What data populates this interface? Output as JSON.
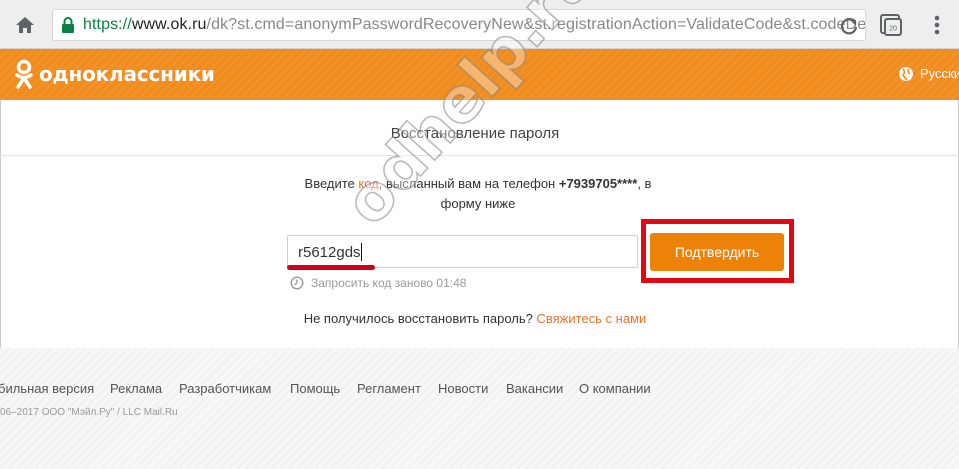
{
  "browser": {
    "url_scheme": "https://",
    "url_host": "www.ok.ru",
    "url_path": "/dk?st.cmd=anonymPasswordRecoveryNew&st.registrationAction=ValidateCode&st.codeDe",
    "tab_count": "20",
    "icons": [
      "home-icon",
      "lock-icon",
      "reload-icon",
      "tabs-icon",
      "menu-icon"
    ]
  },
  "header": {
    "brand": "одноклассники",
    "language": "Русский",
    "brand_color": "#f18c1e"
  },
  "recovery": {
    "title": "Восстановление пароля",
    "instruction": {
      "part1": "Введите ",
      "code_link": "код",
      "part2": ", высланный вам на телефон ",
      "phone": "+7939705****",
      "part3": ", в форму ниже"
    },
    "code_value": "r5612gds",
    "confirm_label": "Подтвердить",
    "resend_label": "Запросить код заново 01:48",
    "help_text": "Не получилось восстановить пароль? ",
    "help_link": "Свяжитесь с нами",
    "accent_color": "#eb722e",
    "button_color": "#ee8208",
    "highlight_color": "#e30613"
  },
  "footer": {
    "links": [
      "бильная версия",
      "Реклама",
      "Разработчикам",
      "Помощь",
      "Регламент",
      "Новости",
      "Вакансии",
      "О компании"
    ],
    "copyright": "06–2017 ООО \"Мэйл.Ру\" / LLC Mail.Ru"
  },
  "watermark": "odhelp.ru"
}
